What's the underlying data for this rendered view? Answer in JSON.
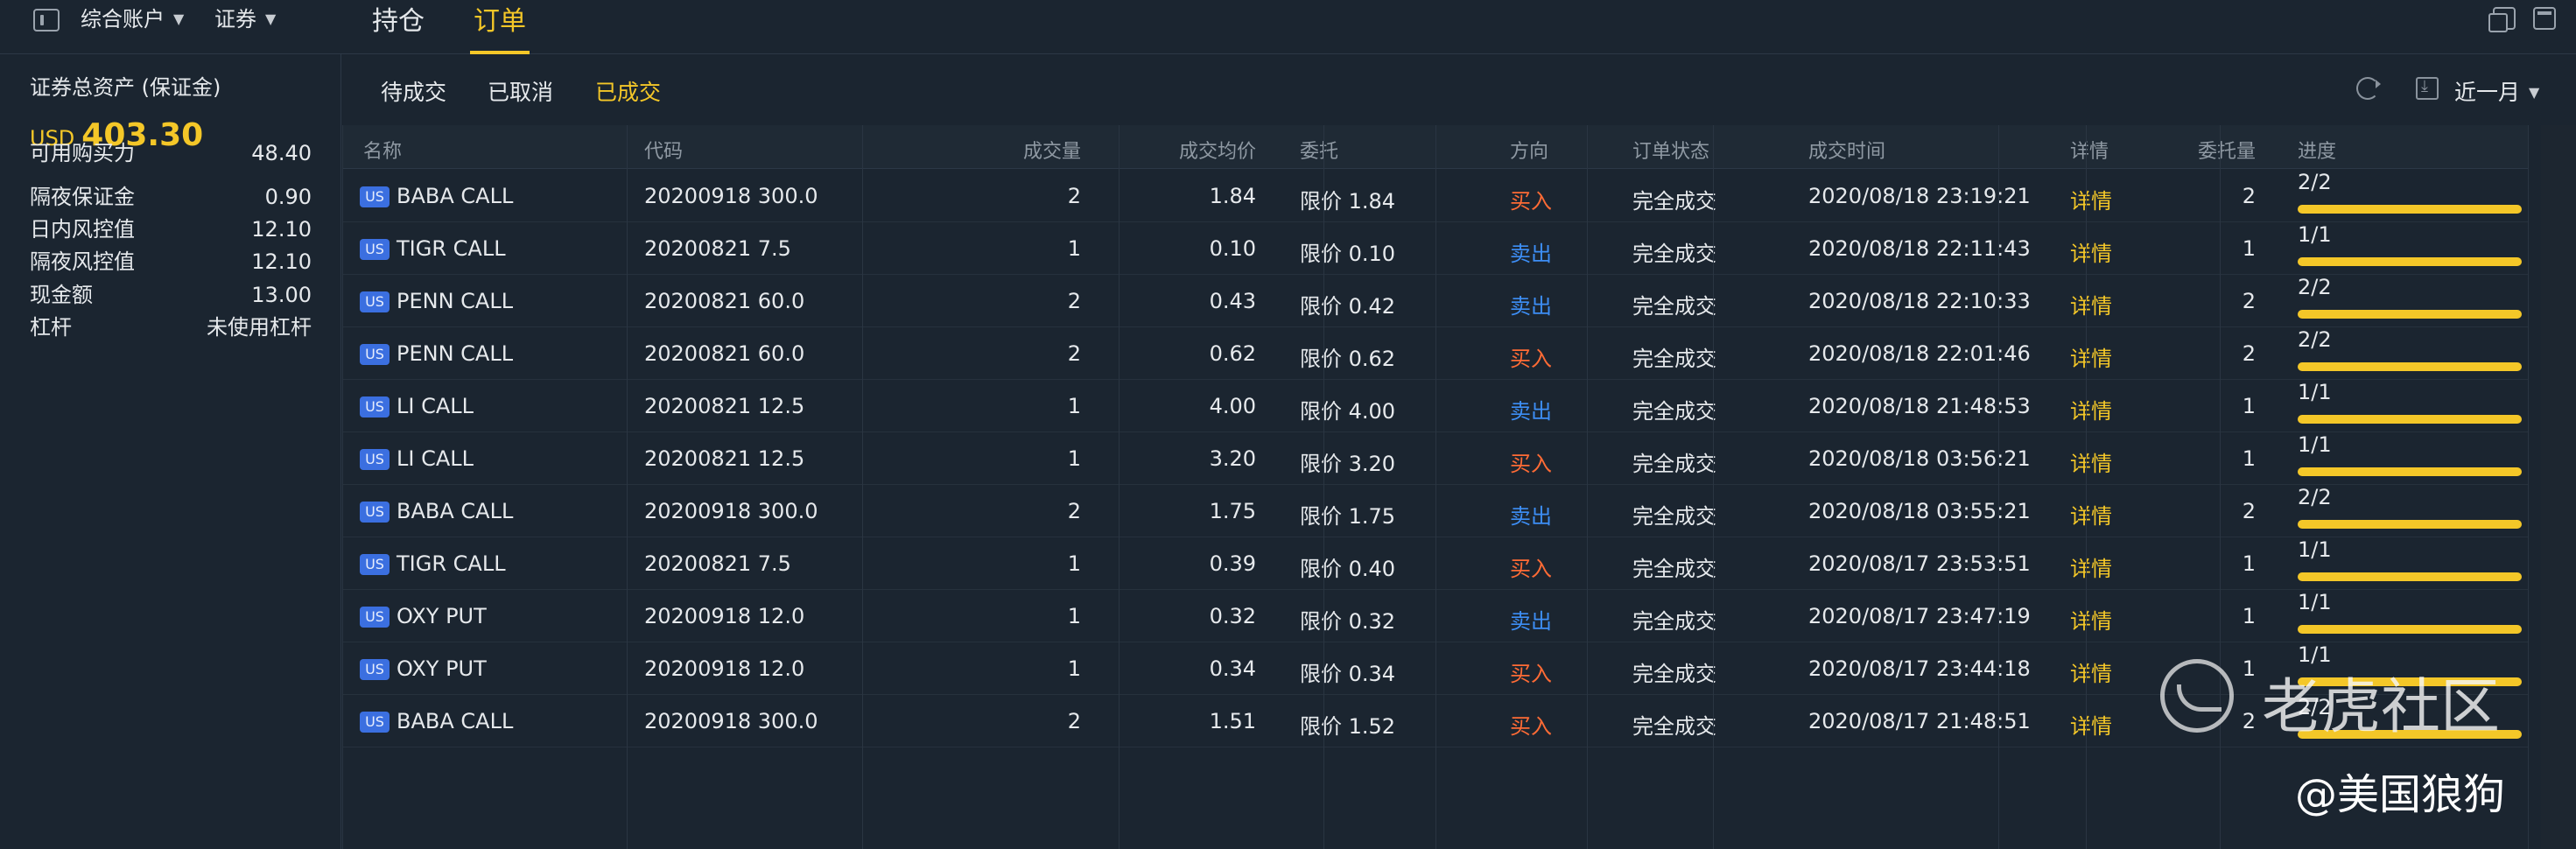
{
  "topbar": {
    "account_label": "综合账户",
    "category_label": "证券",
    "tabs": [
      "持仓",
      "订单"
    ]
  },
  "account": {
    "title": "证券总资产 (保证金)",
    "currency": "USD",
    "total": "403.30",
    "rows": [
      {
        "k": "可用购买力",
        "v": "48.40"
      },
      {
        "k": "隔夜保证金",
        "v": "0.90"
      },
      {
        "k": "日内风控值",
        "v": "12.10"
      },
      {
        "k": "隔夜风控值",
        "v": "12.10"
      },
      {
        "k": "现金额",
        "v": "13.00"
      },
      {
        "k": "杠杆",
        "v": "未使用杠杆"
      }
    ]
  },
  "subtabs": [
    "待成交",
    "已取消",
    "已成交"
  ],
  "range": "近一月",
  "table": {
    "headers": [
      "名称",
      "代码",
      "成交量",
      "成交均价",
      "委托",
      "方向",
      "订单状态",
      "成交时间",
      "详情",
      "委托量",
      "进度"
    ],
    "badge": "US",
    "rows": [
      {
        "name": "BABA CALL",
        "code": "20200918 300.0",
        "qty": "2",
        "avg": "1.84",
        "order": "限价 1.84",
        "side": "买入",
        "side_type": "buy",
        "status": "完全成交",
        "time": "2020/08/18 23:19:21",
        "detail": "详情",
        "oqty": "2",
        "progress": "2/2",
        "fill": 1.0
      },
      {
        "name": "TIGR CALL",
        "code": "20200821 7.5",
        "qty": "1",
        "avg": "0.10",
        "order": "限价 0.10",
        "side": "卖出",
        "side_type": "sell",
        "status": "完全成交",
        "time": "2020/08/18 22:11:43",
        "detail": "详情",
        "oqty": "1",
        "progress": "1/1",
        "fill": 1.0
      },
      {
        "name": "PENN CALL",
        "code": "20200821 60.0",
        "qty": "2",
        "avg": "0.43",
        "order": "限价 0.42",
        "side": "卖出",
        "side_type": "sell",
        "status": "完全成交",
        "time": "2020/08/18 22:10:33",
        "detail": "详情",
        "oqty": "2",
        "progress": "2/2",
        "fill": 1.0
      },
      {
        "name": "PENN CALL",
        "code": "20200821 60.0",
        "qty": "2",
        "avg": "0.62",
        "order": "限价 0.62",
        "side": "买入",
        "side_type": "buy",
        "status": "完全成交",
        "time": "2020/08/18 22:01:46",
        "detail": "详情",
        "oqty": "2",
        "progress": "2/2",
        "fill": 1.0
      },
      {
        "name": "LI CALL",
        "code": "20200821 12.5",
        "qty": "1",
        "avg": "4.00",
        "order": "限价 4.00",
        "side": "卖出",
        "side_type": "sell",
        "status": "完全成交",
        "time": "2020/08/18 21:48:53",
        "detail": "详情",
        "oqty": "1",
        "progress": "1/1",
        "fill": 1.0
      },
      {
        "name": "LI CALL",
        "code": "20200821 12.5",
        "qty": "1",
        "avg": "3.20",
        "order": "限价 3.20",
        "side": "买入",
        "side_type": "buy",
        "status": "完全成交",
        "time": "2020/08/18 03:56:21",
        "detail": "详情",
        "oqty": "1",
        "progress": "1/1",
        "fill": 1.0
      },
      {
        "name": "BABA CALL",
        "code": "20200918 300.0",
        "qty": "2",
        "avg": "1.75",
        "order": "限价 1.75",
        "side": "卖出",
        "side_type": "sell",
        "status": "完全成交",
        "time": "2020/08/18 03:55:21",
        "detail": "详情",
        "oqty": "2",
        "progress": "2/2",
        "fill": 1.0
      },
      {
        "name": "TIGR CALL",
        "code": "20200821 7.5",
        "qty": "1",
        "avg": "0.39",
        "order": "限价 0.40",
        "side": "买入",
        "side_type": "buy",
        "status": "完全成交",
        "time": "2020/08/17 23:53:51",
        "detail": "详情",
        "oqty": "1",
        "progress": "1/1",
        "fill": 1.0
      },
      {
        "name": "OXY PUT",
        "code": "20200918 12.0",
        "qty": "1",
        "avg": "0.32",
        "order": "限价 0.32",
        "side": "卖出",
        "side_type": "sell",
        "status": "完全成交",
        "time": "2020/08/17 23:47:19",
        "detail": "详情",
        "oqty": "1",
        "progress": "1/1",
        "fill": 1.0
      },
      {
        "name": "OXY PUT",
        "code": "20200918 12.0",
        "qty": "1",
        "avg": "0.34",
        "order": "限价 0.34",
        "side": "买入",
        "side_type": "buy",
        "status": "完全成交",
        "time": "2020/08/17 23:44:18",
        "detail": "详情",
        "oqty": "1",
        "progress": "1/1",
        "fill": 1.0
      },
      {
        "name": "BABA CALL",
        "code": "20200918 300.0",
        "qty": "2",
        "avg": "1.51",
        "order": "限价 1.52",
        "side": "买入",
        "side_type": "buy",
        "status": "完全成交",
        "time": "2020/08/17 21:48:51",
        "detail": "详情",
        "oqty": "2",
        "progress": "2/2",
        "fill": 1.0
      }
    ]
  },
  "watermark": {
    "brand": "老虎社区",
    "author": "@美国狼狗"
  },
  "colors": {
    "accent": "#f4c728",
    "buy": "#ff6b35",
    "sell": "#3d8ef5",
    "badge": "#3b6fe0",
    "background": "#1b2530"
  },
  "icons": [
    "sidebar-toggle-icon",
    "caret-down-icon",
    "refresh-icon",
    "download-icon",
    "copy-window-icon",
    "panel-icon",
    "tiger-logo-icon"
  ]
}
